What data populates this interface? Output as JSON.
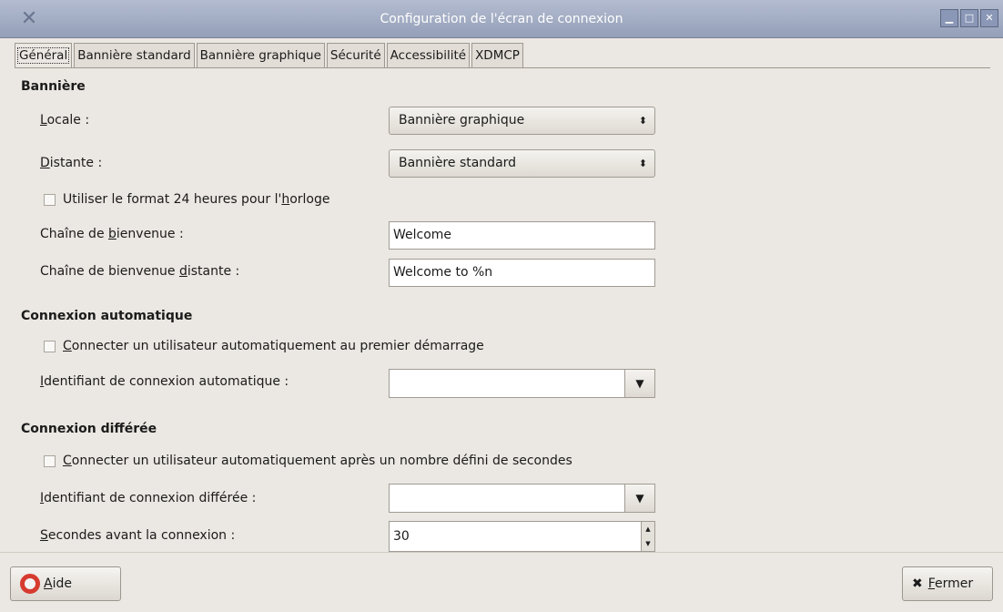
{
  "window": {
    "title": "Configuration de l'écran de connexion",
    "controls": {
      "minimize": "▁",
      "maximize": "□",
      "close": "✕"
    }
  },
  "tabs": [
    {
      "label": "Général",
      "active": true
    },
    {
      "label": "Bannière standard",
      "active": false
    },
    {
      "label": "Bannière graphique",
      "active": false
    },
    {
      "label": "Sécurité",
      "active": false
    },
    {
      "label": "Accessibilité",
      "active": false
    },
    {
      "label": "XDMCP",
      "active": false
    }
  ],
  "banner": {
    "heading": "Bannière",
    "local": {
      "label_mnemonic": "L",
      "label_rest": "ocale :",
      "value": "Bannière graphique"
    },
    "remote": {
      "label_mnemonic": "D",
      "label_rest": "istante :",
      "value": "Bannière standard"
    },
    "clock24": {
      "label_before": "Utiliser le format 24 heures pour l'",
      "label_mnemonic": "h",
      "label_after": "orloge",
      "checked": false
    },
    "welcome": {
      "label_before": "Chaîne de ",
      "label_mnemonic": "b",
      "label_after": "ienvenue :",
      "value": "Welcome"
    },
    "remote_welcome": {
      "label_before": "Chaîne de bienvenue ",
      "label_mnemonic": "d",
      "label_after": "istante :",
      "value": "Welcome to %n"
    }
  },
  "autologin": {
    "heading": "Connexion automatique",
    "enable": {
      "label_mnemonic": "C",
      "label_rest": "onnecter un utilisateur automatiquement au premier démarrage",
      "checked": false
    },
    "user": {
      "label_mnemonic": "I",
      "label_rest": "dentifiant de connexion automatique :",
      "value": ""
    }
  },
  "timed": {
    "heading": "Connexion différée",
    "enable": {
      "label_mnemonic": "C",
      "label_rest": "onnecter un utilisateur automatiquement après un nombre défini de secondes",
      "checked": false
    },
    "user": {
      "label_mnemonic": "I",
      "label_rest": "dentifiant de connexion différée :",
      "value": ""
    },
    "delay": {
      "label_mnemonic": "S",
      "label_rest": "econdes avant la connexion :",
      "value": "30"
    }
  },
  "buttons": {
    "help": {
      "mnemonic": "A",
      "rest": "ide"
    },
    "close": {
      "mnemonic": "F",
      "rest": "ermer"
    }
  },
  "glyphs": {
    "combo_arrow": "⬍",
    "dropdown_arrow": "▼",
    "spin_up": "▲",
    "spin_down": "▼",
    "close_x": "✖"
  }
}
